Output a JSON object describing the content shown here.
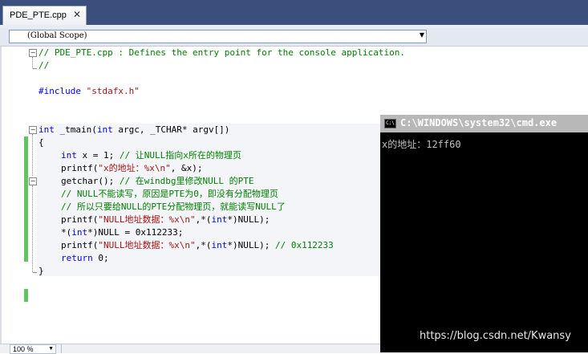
{
  "tab": {
    "label": "PDE_PTE.cpp",
    "close_glyph": "✕"
  },
  "navbar": {
    "scope": "(Global Scope)"
  },
  "code": {
    "l1_a": "//",
    "l1_b": " PDE_PTE.cpp : Defines the entry point for the console application.",
    "l2": "//",
    "l3_kw": "#include",
    "l3_str": " \"stdafx.h\"",
    "l4_kw1": "int",
    "l4_a": " _tmain(",
    "l4_kw2": "int",
    "l4_b": " argc, _TCHAR* argv[])",
    "l5": "{",
    "l6_kw": "int",
    "l6_a": " x = 1; ",
    "l6_cmt": "// 让NULL指向x所在的物理页",
    "l7_a": "printf(",
    "l7_str": "\"x的地址：%x\\n\"",
    "l7_b": ", &x);",
    "l8_a": "getchar(); ",
    "l8_cmt": "// 在windbg里修改NULL 的PTE",
    "l9_cmt": "// NULL不能读写，原因是PTE为0，即没有分配物理页",
    "l10_cmt": "// 所以只要给NULL的PTE分配物理页，就能读写NULL了",
    "l11_a": "printf(",
    "l11_str": "\"NULL地址数据：%x\\n\"",
    "l11_b": ",*(",
    "l11_kw": "int",
    "l11_c": "*)NULL);",
    "l12_a": "*(",
    "l12_kw": "int",
    "l12_b": "*)NULL = 0x112233;",
    "l13_a": "printf(",
    "l13_str": "\"NULL地址数据：%x\\n\"",
    "l13_b": ",*(",
    "l13_kw": "int",
    "l13_c": "*)NULL); ",
    "l13_cmt": "// 0x112233",
    "l14_kw": "return",
    "l14_a": " 0;",
    "l15": "}"
  },
  "status": {
    "zoom": "100 %"
  },
  "console": {
    "title": "C:\\WINDOWS\\system32\\cmd.exe",
    "icon_text": "C:\\",
    "output": "x的地址：12ff60"
  },
  "watermark": "https://blog.csdn.net/Kwansy",
  "colors": {
    "keyword": "#0000ff",
    "string": "#a31515",
    "comment": "#008000",
    "changed_line": "#5fc461"
  },
  "icons": {
    "fold_collapse": "minus-box-icon",
    "combo_arrow": "chevron-down-icon",
    "cmd_icon": "cmd-icon"
  },
  "fold_glyph": "−",
  "arrow_glyph": "▼"
}
